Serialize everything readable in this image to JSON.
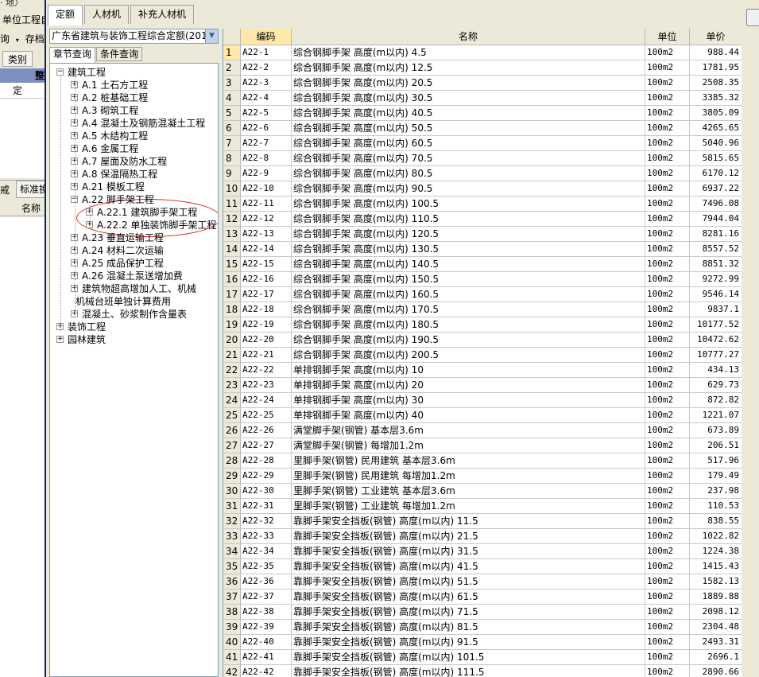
{
  "background_app": {
    "title_fragment": "· 地〉",
    "row1": "单位工程自",
    "row2_label": "询",
    "row2_suffix": "存档",
    "tab_category": "类别",
    "header_fragment": "整",
    "row_value": "定",
    "tab_fragment1": "戒",
    "tab_fragment2": "标准换",
    "col_name": "名称"
  },
  "main_tabs": [
    {
      "label": "定额",
      "active": true
    },
    {
      "label": "人材机",
      "active": false
    },
    {
      "label": "补充人材机",
      "active": false
    }
  ],
  "quota_combo": {
    "value": "广东省建筑与装饰工程综合定额(201",
    "arrow": "chevron-down"
  },
  "sub_tabs": [
    {
      "label": "章节查询",
      "active": true
    },
    {
      "label": "条件查询",
      "active": false
    }
  ],
  "tree": [
    {
      "label": "建筑工程",
      "level": 0,
      "expander": "−"
    },
    {
      "label": "A.1 土石方工程",
      "level": 1,
      "expander": "+"
    },
    {
      "label": "A.2 桩基础工程",
      "level": 1,
      "expander": "+"
    },
    {
      "label": "A.3 砌筑工程",
      "level": 1,
      "expander": "+"
    },
    {
      "label": "A.4 混凝土及钢筋混凝土工程",
      "level": 1,
      "expander": "+"
    },
    {
      "label": "A.5 木结构工程",
      "level": 1,
      "expander": "+"
    },
    {
      "label": "A.6 金属工程",
      "level": 1,
      "expander": "+"
    },
    {
      "label": "A.7 屋面及防水工程",
      "level": 1,
      "expander": "+"
    },
    {
      "label": "A.8 保温隔热工程",
      "level": 1,
      "expander": "+"
    },
    {
      "label": "A.21 模板工程",
      "level": 1,
      "expander": "+"
    },
    {
      "label": "A.22 脚手架工程",
      "level": 1,
      "expander": "−"
    },
    {
      "label": "A.22.1 建筑脚手架工程",
      "level": 2,
      "expander": "+"
    },
    {
      "label": "A.22.2 单独装饰脚手架工程",
      "level": 2,
      "expander": "+"
    },
    {
      "label": "A.23 垂直运输工程",
      "level": 1,
      "expander": "+"
    },
    {
      "label": "A.24 材料二次运输",
      "level": 1,
      "expander": "+"
    },
    {
      "label": "A.25 成品保护工程",
      "level": 1,
      "expander": "+"
    },
    {
      "label": "A.26 混凝土泵送增加费",
      "level": 1,
      "expander": "+"
    },
    {
      "label": "建筑物超高增加人工、机械",
      "level": 1,
      "expander": "+"
    },
    {
      "label": "机械台班单独计算费用",
      "level": 1,
      "expander": ""
    },
    {
      "label": "混凝土、砂浆制作含量表",
      "level": 1,
      "expander": "+"
    },
    {
      "label": "装饰工程",
      "level": 0,
      "expander": "+"
    },
    {
      "label": "园林建筑",
      "level": 0,
      "expander": "+"
    }
  ],
  "grid": {
    "columns": [
      "",
      "编码",
      "名称",
      "单位",
      "单价"
    ],
    "rows": [
      [
        "1",
        "A22-1",
        "综合钢脚手架 高度(m以内) 4.5",
        "100m2",
        "988.44"
      ],
      [
        "2",
        "A22-2",
        "综合钢脚手架 高度(m以内) 12.5",
        "100m2",
        "1781.95"
      ],
      [
        "3",
        "A22-3",
        "综合钢脚手架 高度(m以内) 20.5",
        "100m2",
        "2508.35"
      ],
      [
        "4",
        "A22-4",
        "综合钢脚手架 高度(m以内) 30.5",
        "100m2",
        "3385.32"
      ],
      [
        "5",
        "A22-5",
        "综合钢脚手架 高度(m以内) 40.5",
        "100m2",
        "3805.09"
      ],
      [
        "6",
        "A22-6",
        "综合钢脚手架 高度(m以内) 50.5",
        "100m2",
        "4265.65"
      ],
      [
        "7",
        "A22-7",
        "综合钢脚手架 高度(m以内) 60.5",
        "100m2",
        "5040.96"
      ],
      [
        "8",
        "A22-8",
        "综合钢脚手架 高度(m以内) 70.5",
        "100m2",
        "5815.65"
      ],
      [
        "9",
        "A22-9",
        "综合钢脚手架 高度(m以内) 80.5",
        "100m2",
        "6170.12"
      ],
      [
        "10",
        "A22-10",
        "综合钢脚手架 高度(m以内) 90.5",
        "100m2",
        "6937.22"
      ],
      [
        "11",
        "A22-11",
        "综合钢脚手架 高度(m以内) 100.5",
        "100m2",
        "7496.08"
      ],
      [
        "12",
        "A22-12",
        "综合钢脚手架 高度(m以内) 110.5",
        "100m2",
        "7944.04"
      ],
      [
        "13",
        "A22-13",
        "综合钢脚手架 高度(m以内) 120.5",
        "100m2",
        "8281.16"
      ],
      [
        "14",
        "A22-14",
        "综合钢脚手架 高度(m以内) 130.5",
        "100m2",
        "8557.52"
      ],
      [
        "15",
        "A22-15",
        "综合钢脚手架 高度(m以内) 140.5",
        "100m2",
        "8851.32"
      ],
      [
        "16",
        "A22-16",
        "综合钢脚手架 高度(m以内) 150.5",
        "100m2",
        "9272.99"
      ],
      [
        "17",
        "A22-17",
        "综合钢脚手架 高度(m以内) 160.5",
        "100m2",
        "9546.14"
      ],
      [
        "18",
        "A22-18",
        "综合钢脚手架 高度(m以内) 170.5",
        "100m2",
        "9837.1"
      ],
      [
        "19",
        "A22-19",
        "综合钢脚手架 高度(m以内) 180.5",
        "100m2",
        "10177.52"
      ],
      [
        "20",
        "A22-20",
        "综合钢脚手架 高度(m以内) 190.5",
        "100m2",
        "10472.62"
      ],
      [
        "21",
        "A22-21",
        "综合钢脚手架 高度(m以内) 200.5",
        "100m2",
        "10777.27"
      ],
      [
        "22",
        "A22-22",
        "单排钢脚手架 高度(m以内) 10",
        "100m2",
        "434.13"
      ],
      [
        "23",
        "A22-23",
        "单排钢脚手架 高度(m以内) 20",
        "100m2",
        "629.73"
      ],
      [
        "24",
        "A22-24",
        "单排钢脚手架 高度(m以内) 30",
        "100m2",
        "872.82"
      ],
      [
        "25",
        "A22-25",
        "单排钢脚手架 高度(m以内) 40",
        "100m2",
        "1221.07"
      ],
      [
        "26",
        "A22-26",
        "满堂脚手架(钢管) 基本层3.6m",
        "100m2",
        "673.89"
      ],
      [
        "27",
        "A22-27",
        "满堂脚手架(钢管) 每增加1.2m",
        "100m2",
        "206.51"
      ],
      [
        "28",
        "A22-28",
        "里脚手架(钢管) 民用建筑 基本层3.6m",
        "100m2",
        "517.96"
      ],
      [
        "29",
        "A22-29",
        "里脚手架(钢管) 民用建筑 每增加1.2m",
        "100m2",
        "179.49"
      ],
      [
        "30",
        "A22-30",
        "里脚手架(钢管) 工业建筑 基本层3.6m",
        "100m2",
        "237.98"
      ],
      [
        "31",
        "A22-31",
        "里脚手架(钢管) 工业建筑 每增加1.2m",
        "100m2",
        "110.53"
      ],
      [
        "32",
        "A22-32",
        "靠脚手架安全挡板(钢管) 高度(m以内) 11.5",
        "100m2",
        "838.55"
      ],
      [
        "33",
        "A22-33",
        "靠脚手架安全挡板(钢管) 高度(m以内) 21.5",
        "100m2",
        "1022.82"
      ],
      [
        "34",
        "A22-34",
        "靠脚手架安全挡板(钢管) 高度(m以内) 31.5",
        "100m2",
        "1224.38"
      ],
      [
        "35",
        "A22-35",
        "靠脚手架安全挡板(钢管) 高度(m以内) 41.5",
        "100m2",
        "1415.43"
      ],
      [
        "36",
        "A22-36",
        "靠脚手架安全挡板(钢管) 高度(m以内) 51.5",
        "100m2",
        "1582.13"
      ],
      [
        "37",
        "A22-37",
        "靠脚手架安全挡板(钢管) 高度(m以内) 61.5",
        "100m2",
        "1889.88"
      ],
      [
        "38",
        "A22-38",
        "靠脚手架安全挡板(钢管) 高度(m以内) 71.5",
        "100m2",
        "2098.12"
      ],
      [
        "39",
        "A22-39",
        "靠脚手架安全挡板(钢管) 高度(m以内) 81.5",
        "100m2",
        "2304.48"
      ],
      [
        "40",
        "A22-40",
        "靠脚手架安全挡板(钢管) 高度(m以内) 91.5",
        "100m2",
        "2493.31"
      ],
      [
        "41",
        "A22-41",
        "靠脚手架安全挡板(钢管) 高度(m以内) 101.5",
        "100m2",
        "2696.1"
      ],
      [
        "42",
        "A22-42",
        "靠脚手架安全挡板(钢管) 高度(m以内) 111.5",
        "100m2",
        "2890.66"
      ]
    ]
  },
  "colors": {
    "window_bg": "#ece9d8",
    "selected_header": "#ffe9a8",
    "highlight_ellipse": "#d9231f",
    "window_border": "#0a246a"
  }
}
